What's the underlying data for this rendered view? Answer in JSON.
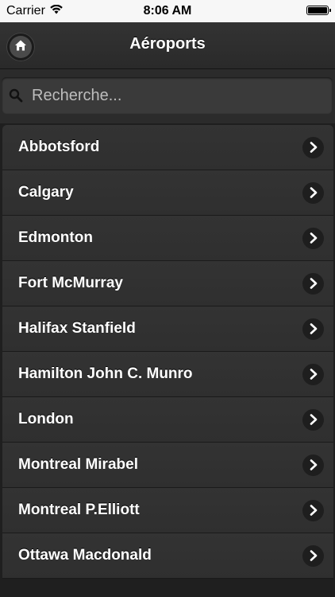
{
  "status_bar": {
    "carrier": "Carrier",
    "time": "8:06 AM",
    "battery_level": 1.0
  },
  "header": {
    "title": "Aéroports",
    "home_icon": "home-icon"
  },
  "search": {
    "placeholder": "Recherche...",
    "value": ""
  },
  "airports": [
    {
      "label": "Abbotsford"
    },
    {
      "label": "Calgary"
    },
    {
      "label": "Edmonton"
    },
    {
      "label": "Fort McMurray"
    },
    {
      "label": "Halifax Stanfield"
    },
    {
      "label": "Hamilton John C. Munro"
    },
    {
      "label": "London"
    },
    {
      "label": "Montreal Mirabel"
    },
    {
      "label": "Montreal P.Elliott"
    },
    {
      "label": "Ottawa Macdonald"
    }
  ],
  "colors": {
    "background": "#1f1f1f",
    "header": "#2e2e2e",
    "row": "#313131",
    "text": "#ffffff"
  }
}
